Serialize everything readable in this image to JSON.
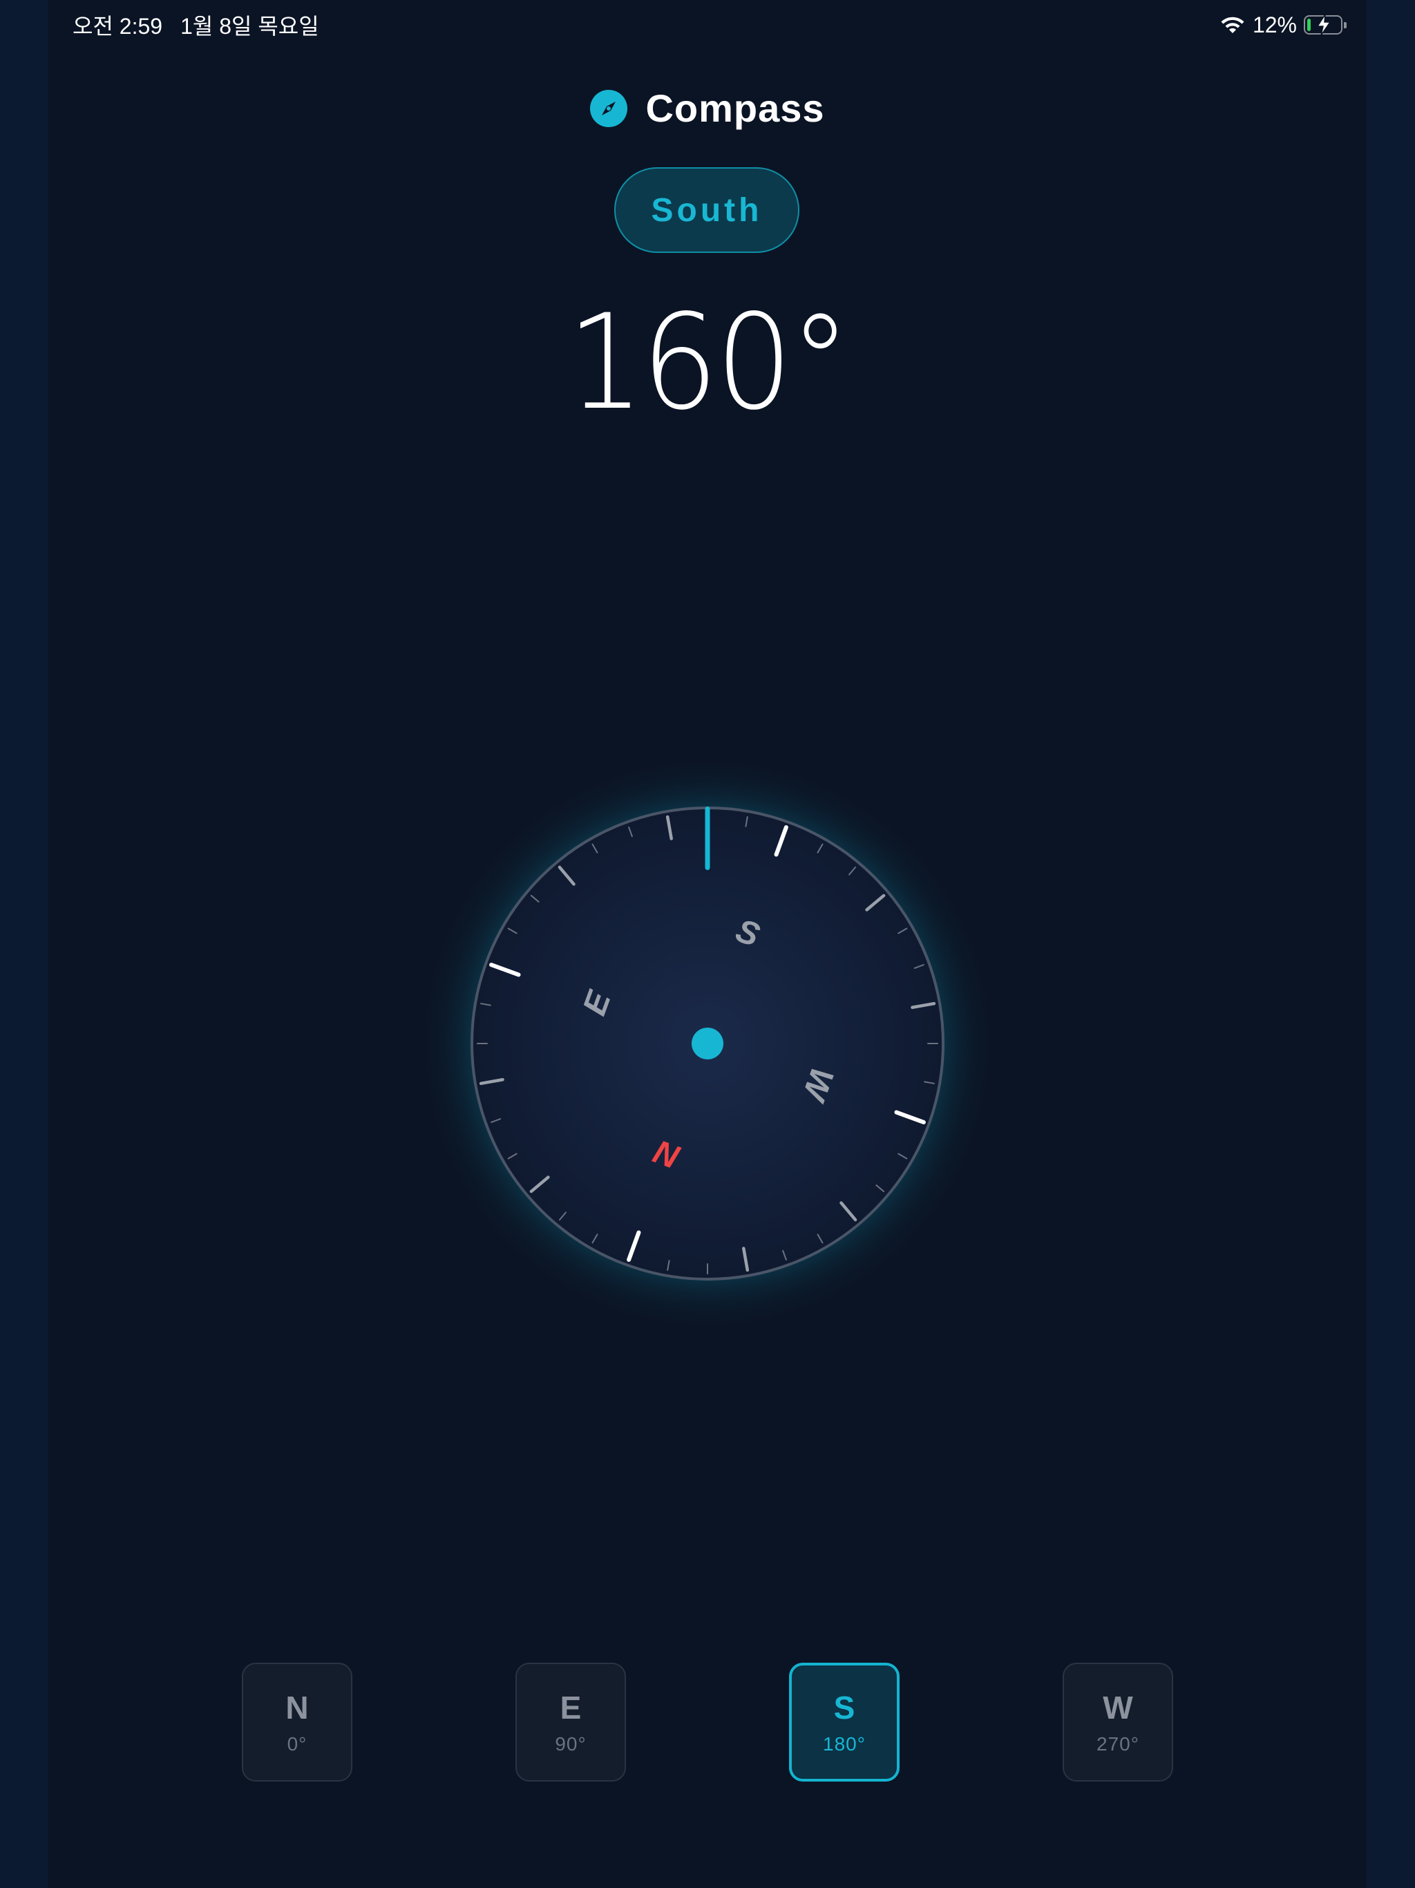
{
  "status_bar": {
    "time": "오전 2:59",
    "date": "1월 8일 목요일",
    "battery_percent": "12%",
    "battery_level": 0.12,
    "icons": [
      "wifi-icon",
      "battery-charging-icon"
    ]
  },
  "header": {
    "icon": "compass-icon",
    "title": "Compass"
  },
  "direction_label": "South",
  "heading": "160°",
  "compass": {
    "heading_degrees": 160,
    "labels": {
      "n": "N",
      "e": "E",
      "s": "S",
      "w": "W"
    }
  },
  "cardinals": [
    {
      "letter": "N",
      "degrees": "0°",
      "active": false
    },
    {
      "letter": "E",
      "degrees": "90°",
      "active": false
    },
    {
      "letter": "S",
      "degrees": "180°",
      "active": true
    },
    {
      "letter": "W",
      "degrees": "270°",
      "active": false
    }
  ],
  "colors": {
    "accent": "#17b7d4",
    "background": "#0b1424",
    "north": "#ef4444",
    "text": "#ffffff"
  }
}
